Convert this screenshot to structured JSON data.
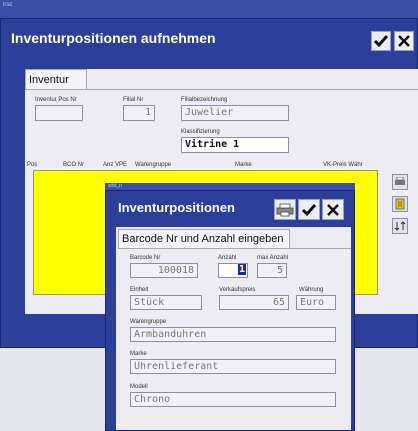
{
  "top_caption": "irsc",
  "main_window": {
    "title": "Inventurpositionen aufnehmen",
    "tab_label": "Inventur",
    "fields": {
      "pos_nr": {
        "label": "Inventur Pos Nr",
        "value": ""
      },
      "filial_nr": {
        "label": "Filial Nr",
        "value": "1"
      },
      "filial_name": {
        "label": "Filialbezeichnung",
        "value": "Juwelier"
      },
      "klassifizierung": {
        "label": "Klassifizierung",
        "value": "Vitrine 1"
      }
    },
    "table_headers": [
      "Pos",
      "BCO Nr",
      "Anz VPE",
      "Warengruppe",
      "Marke",
      "VK-Preis Währ"
    ]
  },
  "dialog": {
    "caption": "srbt_n",
    "title": "Inventurpositionen",
    "tab_label": "Barcode Nr und Anzahl eingeben",
    "fields": {
      "barcode": {
        "label": "Barcode Nr",
        "value": "100018"
      },
      "anzahl": {
        "label": "Anzahl",
        "value": "1"
      },
      "max_anzahl": {
        "label": "max Anzahl",
        "value": "5"
      },
      "einheit": {
        "label": "Einheit",
        "value": "Stück"
      },
      "verkaufspreis": {
        "label": "Verkaufspreis",
        "value": "65"
      },
      "waehrung": {
        "label": "Währung",
        "value": "Euro"
      },
      "warengruppe": {
        "label": "Warengruppe",
        "value": "Armbanduhren"
      },
      "marke": {
        "label": "Marke",
        "value": "Uhrenlieferant"
      },
      "modell": {
        "label": "Modell",
        "value": "Chrono"
      }
    }
  },
  "colors": {
    "window_blue": "#2c3f9a",
    "highlight_yellow": "#ffff00",
    "panel": "#ececf2"
  },
  "icons": [
    "check-icon",
    "close-icon",
    "printer-icon",
    "print-icon",
    "list-icon",
    "sort-icon"
  ]
}
